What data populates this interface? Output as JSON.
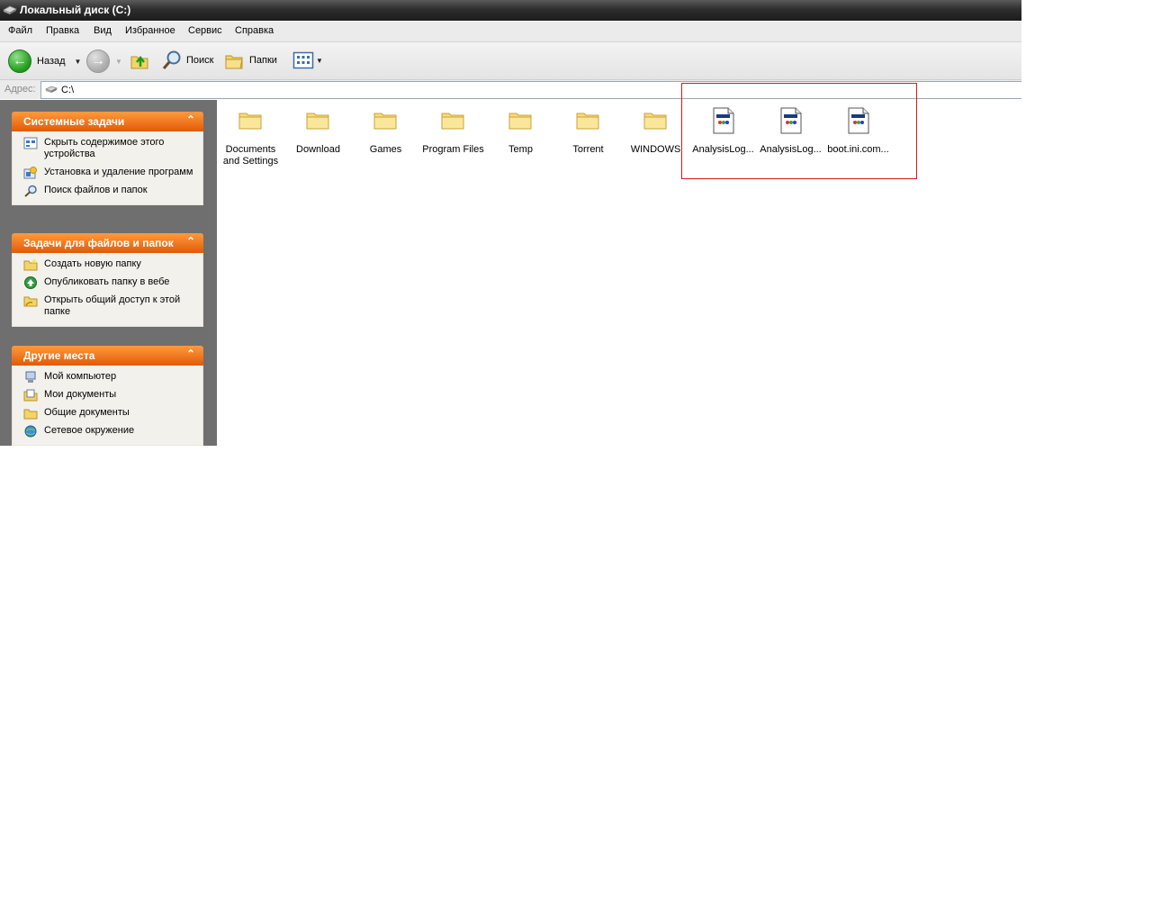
{
  "window": {
    "title": "Локальный диск (C:)"
  },
  "menu": [
    "Файл",
    "Правка",
    "Вид",
    "Избранное",
    "Сервис",
    "Справка"
  ],
  "toolbar": {
    "back_label": "Назад",
    "search_label": "Поиск",
    "folders_label": "Папки"
  },
  "address": {
    "label": "Адрес:",
    "value": "C:\\"
  },
  "sidebar": {
    "panels": [
      {
        "title": "Системные задачи",
        "items": [
          {
            "label": "Скрыть содержимое этого устройства",
            "icon": "hide-contents-icon"
          },
          {
            "label": "Установка и удаление программ",
            "icon": "add-remove-programs-icon"
          },
          {
            "label": "Поиск файлов и папок",
            "icon": "search-icon"
          }
        ]
      },
      {
        "title": "Задачи для файлов и папок",
        "items": [
          {
            "label": "Создать новую папку",
            "icon": "new-folder-icon"
          },
          {
            "label": "Опубликовать папку в вебе",
            "icon": "publish-web-icon"
          },
          {
            "label": "Открыть общий доступ к этой папке",
            "icon": "share-folder-icon"
          }
        ]
      },
      {
        "title": "Другие места",
        "items": [
          {
            "label": "Мой компьютер",
            "icon": "my-computer-icon"
          },
          {
            "label": "Мои документы",
            "icon": "my-documents-icon"
          },
          {
            "label": "Общие документы",
            "icon": "shared-documents-icon"
          },
          {
            "label": "Сетевое окружение",
            "icon": "network-places-icon"
          }
        ]
      }
    ]
  },
  "files": [
    {
      "label": "Documents\nand Settings",
      "type": "folder"
    },
    {
      "label": "Download",
      "type": "folder"
    },
    {
      "label": "Games",
      "type": "folder"
    },
    {
      "label": "Program Files",
      "type": "folder"
    },
    {
      "label": "Temp",
      "type": "folder"
    },
    {
      "label": "Torrent",
      "type": "folder"
    },
    {
      "label": "WINDOWS",
      "type": "folder"
    },
    {
      "label": "AnalysisLog...",
      "type": "file"
    },
    {
      "label": "AnalysisLog...",
      "type": "file"
    },
    {
      "label": "boot.ini.com...",
      "type": "file"
    }
  ],
  "colors": {
    "panel_header": "#e8670f",
    "highlight_box": "#d31a1a",
    "title_bar": "#2e2e2e"
  }
}
